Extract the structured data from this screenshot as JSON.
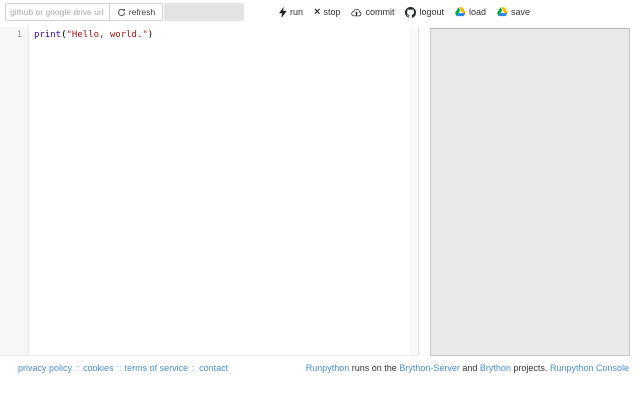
{
  "toolbar": {
    "url_placeholder": "github or google drive url",
    "url_value": "",
    "refresh_label": "refresh",
    "filename_value": "",
    "run_label": "run",
    "stop_label": "stop",
    "stop_glyph": "×",
    "commit_label": "commit",
    "logout_label": "logout",
    "load_label": "load",
    "save_label": "save"
  },
  "editor": {
    "line_number": "1",
    "tokens": {
      "builtin": "print",
      "paren_open": "(",
      "string": "\"Hello, world.\"",
      "paren_close": ")"
    }
  },
  "footer": {
    "links": [
      "privacy policy",
      "cookies",
      "terms of service",
      "contact"
    ],
    "separator": "::",
    "credits": {
      "runpython_link": "Runpython",
      "mid1": " runs on the ",
      "brython_server_link": "Brython-Server",
      "mid2": " and ",
      "brython_link": "Brython",
      "mid3": " projects. ",
      "console_link": "Runpython Console"
    }
  },
  "colors": {
    "link_blue": "#4a8fd0",
    "builtin_purple": "#3300aa",
    "string_red": "#aa1111",
    "panel_gray": "#e9e9e9",
    "drive_green": "#00ac47",
    "drive_yellow": "#ffba00",
    "drive_blue": "#2684fc"
  }
}
